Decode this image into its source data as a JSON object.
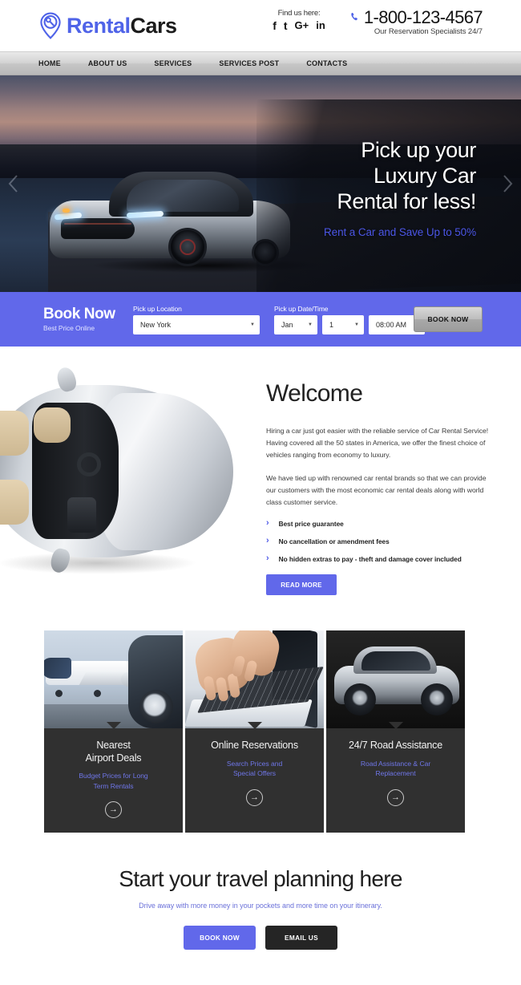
{
  "header": {
    "logo": {
      "part1": "Rental",
      "part2": "Cars",
      "icon": "location-pin-key-icon"
    },
    "social": {
      "title": "Find us here:",
      "items": [
        {
          "name": "facebook",
          "glyph": "f"
        },
        {
          "name": "twitter",
          "glyph": "t"
        },
        {
          "name": "google-plus",
          "glyph": "G+"
        },
        {
          "name": "linkedin",
          "glyph": "in"
        }
      ]
    },
    "phone": {
      "number": "1-800-123-4567",
      "subtitle": "Our Reservation Specialists 24/7",
      "icon": "phone-icon"
    }
  },
  "nav": {
    "items": [
      {
        "label": "HOME"
      },
      {
        "label": "ABOUT US"
      },
      {
        "label": "SERVICES"
      },
      {
        "label": "SERVICES POST"
      },
      {
        "label": "CONTACTS"
      }
    ]
  },
  "hero": {
    "line1": "Pick up your",
    "line2": "Luxury Car",
    "line3": "Rental for less!",
    "subtitle": "Rent a Car and Save Up to 50%",
    "prev_icon": "chevron-left-icon",
    "next_icon": "chevron-right-icon"
  },
  "booking": {
    "title": "Book Now",
    "subtitle": "Best Price Online",
    "location_label": "Pick up Location",
    "datetime_label": "Pick up Date/Time",
    "location_value": "New York",
    "month_value": "Jan",
    "day_value": "1",
    "time_value": "08:00 AM",
    "button_label": "BOOK NOW"
  },
  "welcome": {
    "heading": "Welcome",
    "paragraph1": "Hiring a car just got easier with the reliable service of Car Rental Service! Having covered all the 50 states in America, we offer the finest choice of vehicles ranging from economy to luxury.",
    "paragraph2": "We have tied up with renowned car rental brands so that we can provide our customers with the most economic car rental deals along with world class customer service.",
    "bullets": [
      "Best price guarantee",
      "No cancellation or amendment fees",
      "No hidden extras to pay - theft and damage cover included"
    ],
    "button_label": "READ MORE",
    "image_alt": "silver-convertible-car-top-view"
  },
  "cards": [
    {
      "title_line1": "Nearest",
      "title_line2": "Airport Deals",
      "subtitle_line1": "Budget Prices for Long",
      "subtitle_line2": "Term Rentals",
      "arrow_icon": "arrow-right-circle-icon",
      "image_alt": "private-jet-and-car"
    },
    {
      "title_line1": "Online Reservations",
      "title_line2": "",
      "subtitle_line1": "Search Prices and",
      "subtitle_line2": "Special Offers",
      "arrow_icon": "arrow-right-circle-icon",
      "image_alt": "hands-typing-on-laptop"
    },
    {
      "title_line1": "24/7 Road Assistance",
      "title_line2": "",
      "subtitle_line1": "Road Assistance & Car",
      "subtitle_line2": "Replacement",
      "arrow_icon": "arrow-right-circle-icon",
      "image_alt": "silver-suv"
    }
  ],
  "cta": {
    "heading": "Start your travel planning here",
    "subtitle": "Drive away with more money in your pockets and more time on your itinerary.",
    "primary_label": "BOOK NOW",
    "secondary_label": "EMAIL US"
  },
  "colors": {
    "accent": "#6168ea",
    "accent_text": "#4f5ae8",
    "card_bg": "#303030",
    "dark_button": "#252525"
  }
}
